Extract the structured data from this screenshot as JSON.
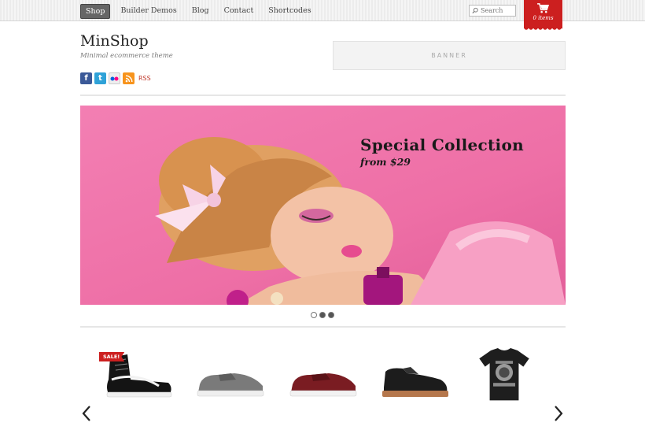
{
  "nav": {
    "items": [
      {
        "label": "Shop",
        "active": true
      },
      {
        "label": "Builder Demos",
        "active": false
      },
      {
        "label": "Blog",
        "active": false
      },
      {
        "label": "Contact",
        "active": false
      },
      {
        "label": "Shortcodes",
        "active": false
      }
    ]
  },
  "search": {
    "placeholder": "Search",
    "icon": "search-icon"
  },
  "cart": {
    "label": "0 items",
    "icon": "cart-icon",
    "color": "#cc1f1f"
  },
  "site": {
    "title": "MinShop",
    "tagline": "Minimal ecommerce theme"
  },
  "social": {
    "icons": [
      "facebook-icon",
      "twitter-icon",
      "flickr-icon",
      "rss-icon"
    ],
    "rss_label": "RSS"
  },
  "banner": {
    "label": "BANNER"
  },
  "hero": {
    "title": "Special Collection",
    "subtitle": "from $29",
    "background": "#ee6fa6"
  },
  "slider": {
    "slide_count": 3,
    "active_slide": 2
  },
  "products": {
    "sale_badge": "SALE!",
    "items": [
      "high-top-sneaker",
      "grey-sneaker",
      "maroon-sneaker",
      "leather-chukka-boot",
      "graphic-tshirt"
    ]
  },
  "carousel": {
    "prev_icon": "chevron-left-icon",
    "next_icon": "chevron-right-icon"
  }
}
